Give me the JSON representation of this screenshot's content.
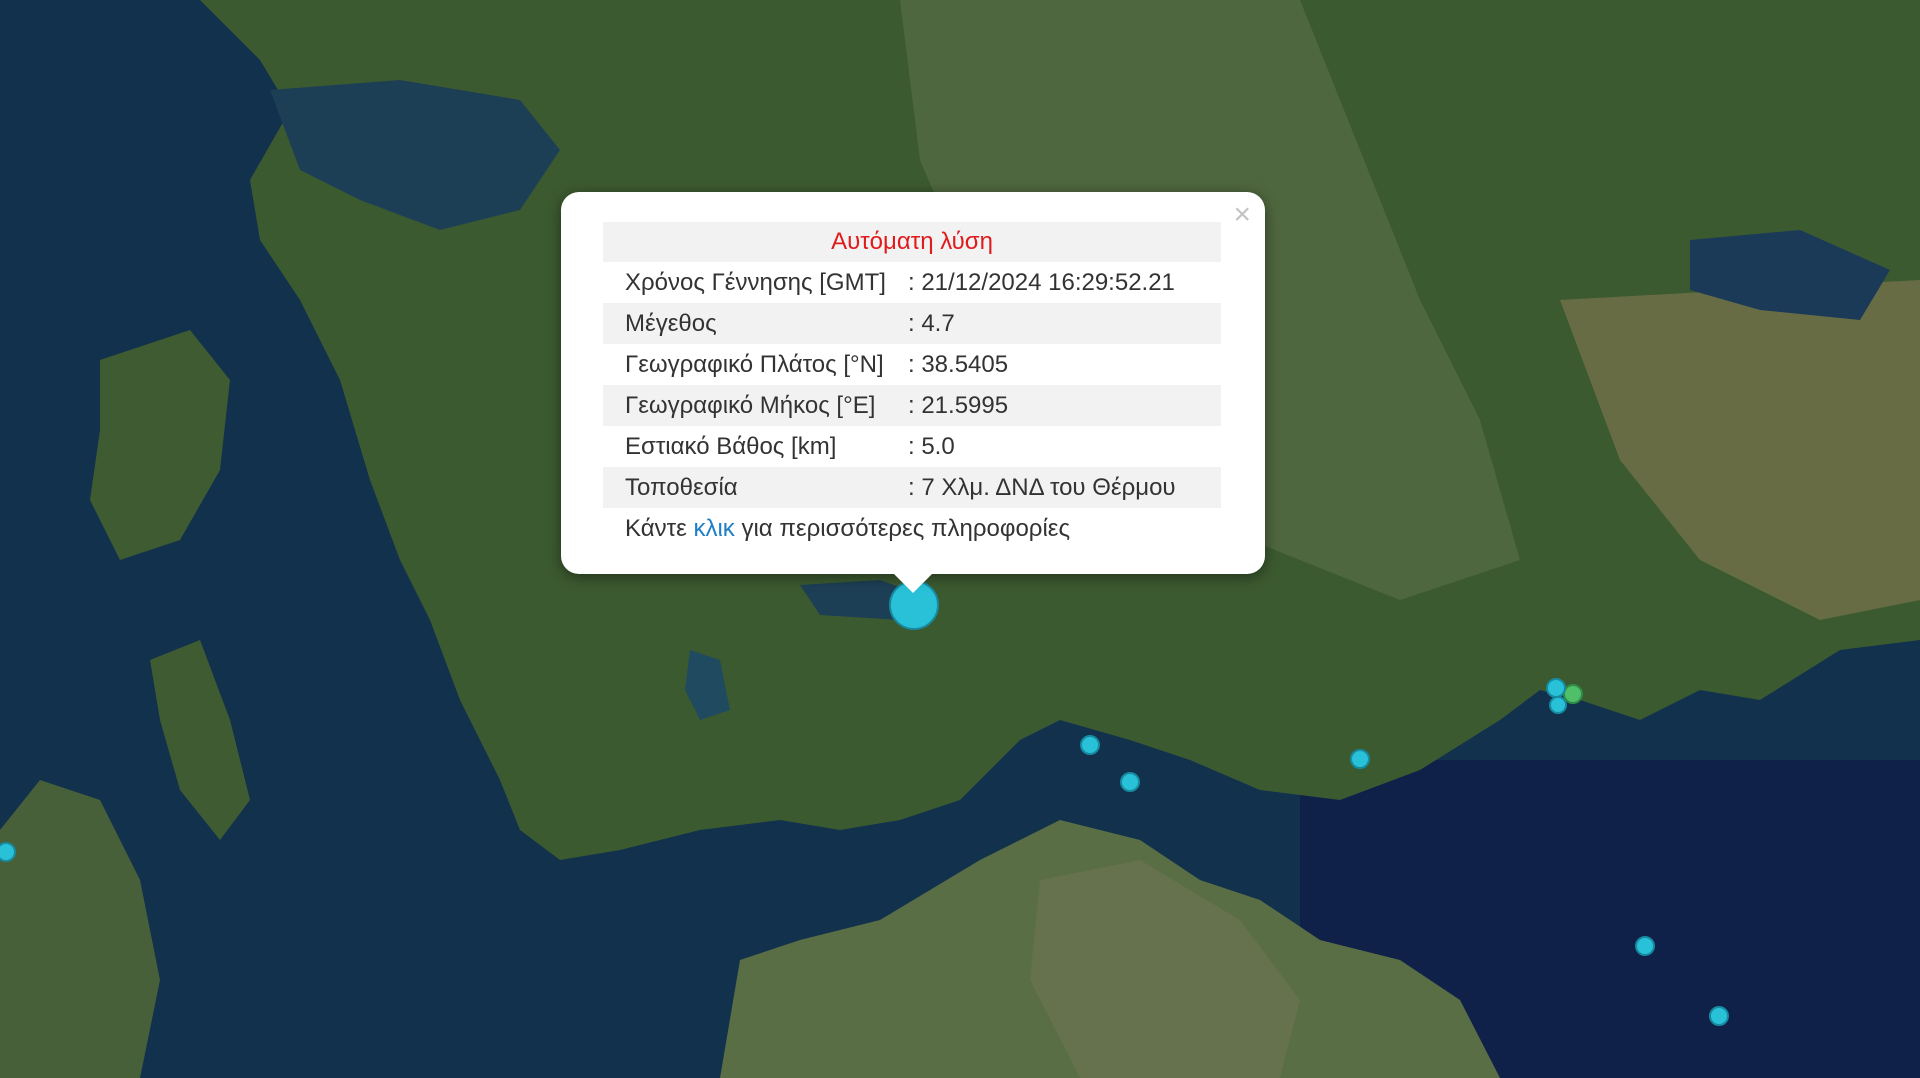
{
  "popup": {
    "title": "Αυτόματη λύση",
    "rows": [
      {
        "label": "Χρόνος Γέννησης [GMT]",
        "value": ": 21/12/2024 16:29:52.21"
      },
      {
        "label": "Μέγεθος",
        "value": ": 4.7"
      },
      {
        "label": "Γεωγραφικό Πλάτος [°N]",
        "value": ": 38.5405"
      },
      {
        "label": "Γεωγραφικό Μήκος [°E]",
        "value": ": 21.5995"
      },
      {
        "label": "Εστιακό Βάθος [km]",
        "value": ": 5.0"
      },
      {
        "label": "Τοποθεσία",
        "value": ": 7 Χλμ. ΔΝΔ του Θέρμου"
      }
    ],
    "more_prefix": "Κάντε",
    "more_link": "κλικ",
    "more_suffix": "για περισσότερες πληροφορίες",
    "close_icon": "×"
  },
  "colors": {
    "title_red": "#e01b1b",
    "link_blue": "#1f7fc6",
    "quake_cyan": "#29c1d8",
    "quake_green": "#4fbf6a"
  }
}
